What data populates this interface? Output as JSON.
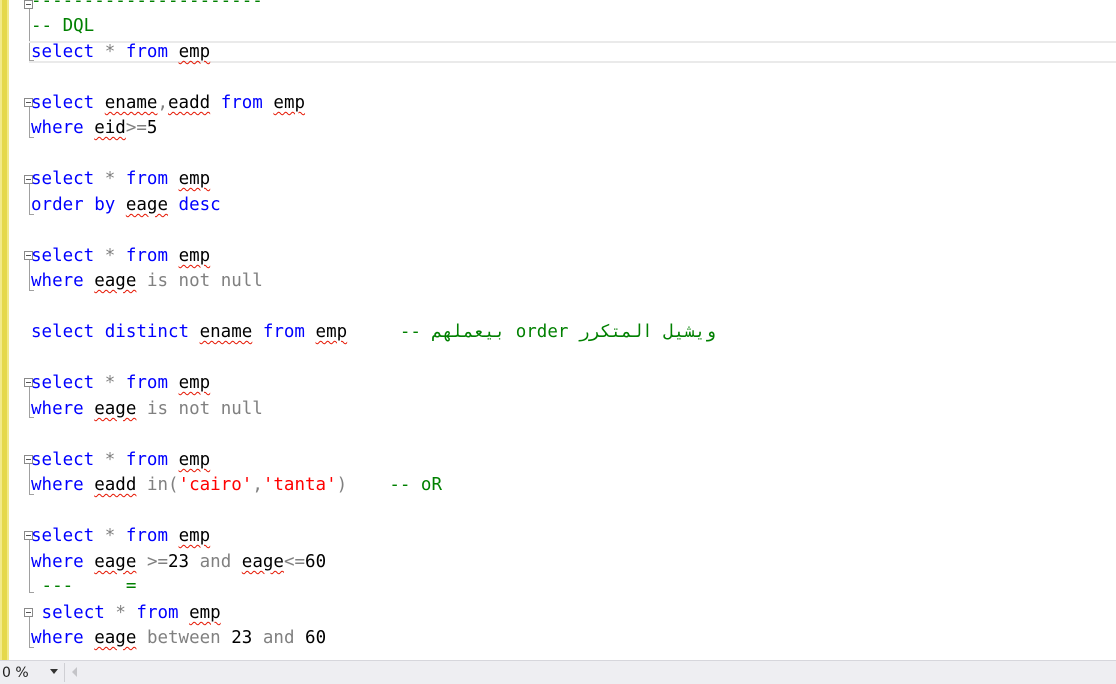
{
  "editor": {
    "lines": {
      "dash_separator": "----------------------",
      "dql_comment": "-- DQL",
      "l1_select": "select",
      "l1_star": "*",
      "l1_from": "from",
      "l1_table": "emp",
      "q1_select": "select",
      "q1_cols_a": "ename",
      "q1_comma": ",",
      "q1_cols_b": "eadd",
      "q1_from": "from",
      "q1_table": "emp",
      "q1_where": "where",
      "q1_col": "eid",
      "q1_op": ">=",
      "q1_val": "5",
      "q2_select": "select",
      "q2_star": "*",
      "q2_from": "from",
      "q2_table": "emp",
      "q2_order": "order by",
      "q2_col": "eage",
      "q2_desc": "desc",
      "q3_select": "select",
      "q3_star": "*",
      "q3_from": "from",
      "q3_table": "emp",
      "q3_where": "where",
      "q3_col": "eage",
      "q3_cond": "is not null",
      "q4_select": "select distinct",
      "q4_col": "ename",
      "q4_from": "from",
      "q4_table": "emp",
      "q4_comment": "-- بيعملهم order ويشيل المتكرر",
      "q5_select": "select",
      "q5_star": "*",
      "q5_from": "from",
      "q5_table": "emp",
      "q5_where": "where",
      "q5_col": "eage",
      "q5_cond": "is not null",
      "q6_select": "select",
      "q6_star": "*",
      "q6_from": "from",
      "q6_table": "emp",
      "q6_where": "where",
      "q6_col": "eadd",
      "q6_in": "in(",
      "q6_s1": "'cairo'",
      "q6_comma": ",",
      "q6_s2": "'tanta'",
      "q6_close": ")",
      "q6_comment": "-- oR",
      "q7_select": "select",
      "q7_star": "*",
      "q7_from": "from",
      "q7_table": "emp",
      "q7_where": "where",
      "q7_col": "eage",
      "q7_op1": ">=",
      "q7_v1": "23",
      "q7_and": "and",
      "q7_col2": "eage",
      "q7_op2": "<=",
      "q7_v2": "60",
      "q7_note_dash": "---",
      "q7_note_eq": "=",
      "q8_select": "select",
      "q8_star": "*",
      "q8_from": "from",
      "q8_table": "emp",
      "q8_where": "where",
      "q8_col": "eage",
      "q8_between": "between",
      "q8_v1": "23",
      "q8_and": "and",
      "q8_v2": "60"
    }
  },
  "statusbar": {
    "zoom": "0 %"
  },
  "colors": {
    "keyword": "#0000ff",
    "operator": "#808080",
    "comment": "#008000",
    "string": "#ff0000",
    "change_margin": "#f2ea88"
  }
}
